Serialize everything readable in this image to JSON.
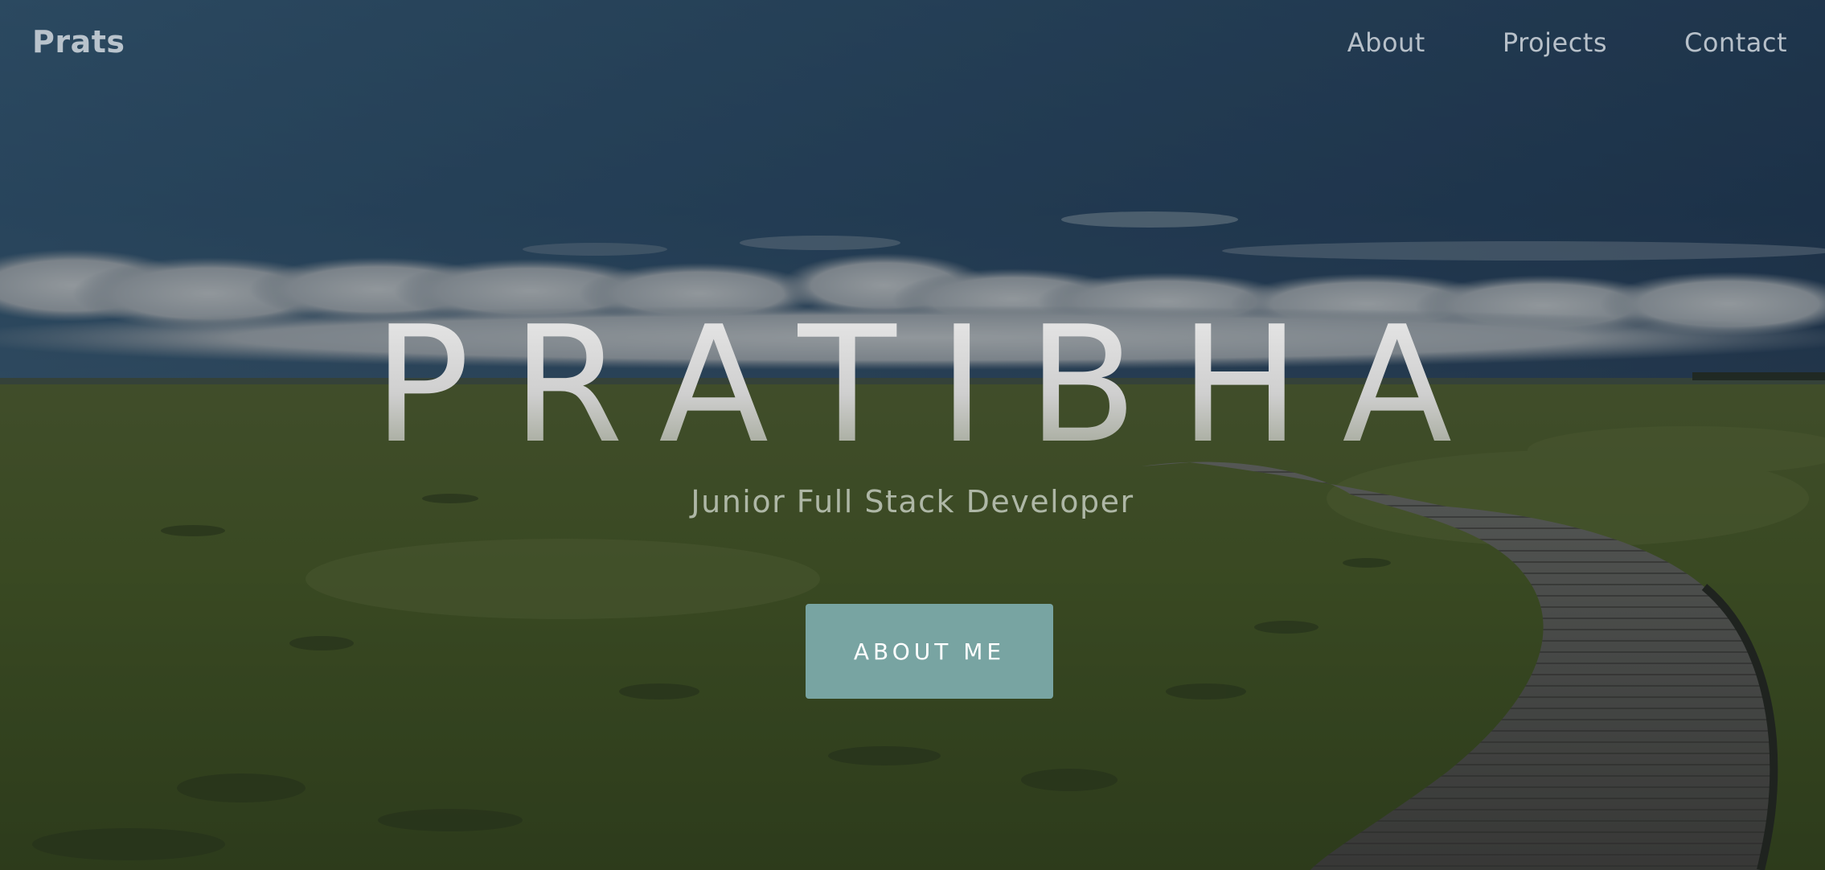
{
  "nav": {
    "brand": "Prats",
    "links": [
      {
        "label": "About"
      },
      {
        "label": "Projects"
      },
      {
        "label": "Contact"
      }
    ]
  },
  "hero": {
    "title": "PRATIBHA",
    "subtitle": "Junior Full Stack Developer",
    "cta_label": "ABOUT ME",
    "background": "photo: marsh meadow with wooden boardwalk under blue sky with clouds"
  },
  "colors": {
    "accent": "#78a4a2",
    "nav_text": "#b7c0c9",
    "sky": "#2f5272",
    "grass": "#4f6020",
    "boardwalk": "#5e584f"
  }
}
